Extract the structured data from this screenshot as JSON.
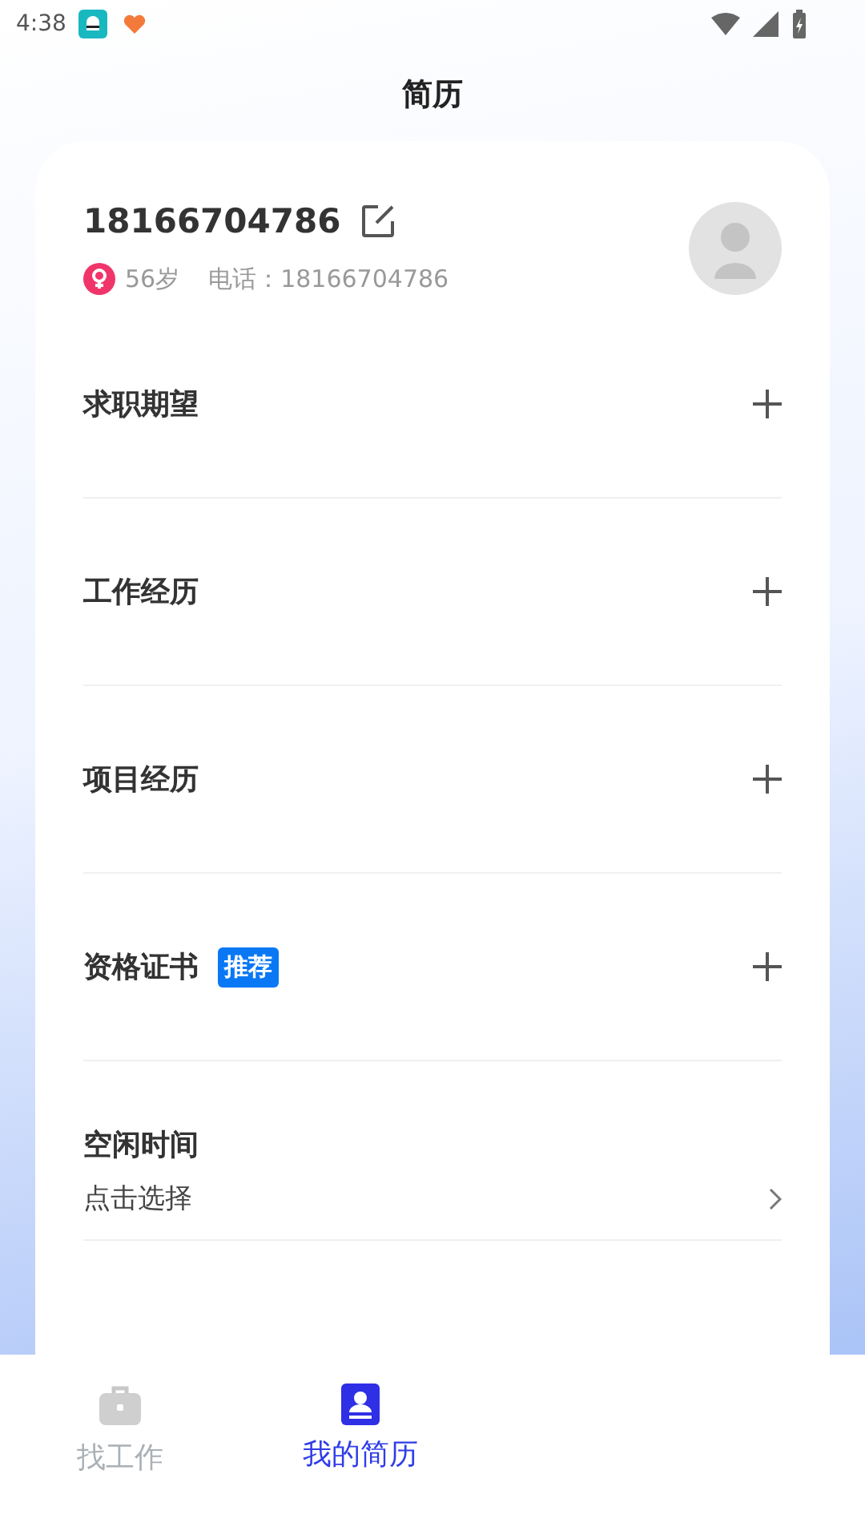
{
  "status_bar": {
    "time": "4:38"
  },
  "header": {
    "title": "简历"
  },
  "profile": {
    "name": "18166704786",
    "gender": {
      "kind": "female"
    },
    "age": "56岁",
    "phone_label": "电话：",
    "phone": "18166704786"
  },
  "sections": [
    {
      "kind": "add",
      "title": "求职期望"
    },
    {
      "kind": "add",
      "title": "工作经历"
    },
    {
      "kind": "add",
      "title": "项目经历"
    },
    {
      "kind": "add",
      "title": "资格证书",
      "badge": "推荐"
    },
    {
      "kind": "select",
      "title": "空闲时间",
      "value": "点击选择"
    }
  ],
  "tabs": [
    {
      "label": "找工作",
      "kind": "briefcase",
      "selected": false
    },
    {
      "label": "我的简历",
      "kind": "resume",
      "selected": true
    }
  ]
}
